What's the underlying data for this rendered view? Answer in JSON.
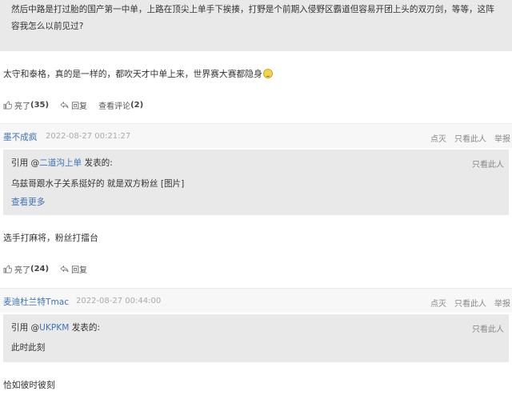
{
  "top_quote": {
    "text": "然后中路是打过胎的国产第一中单，上路在顶尖上单手下挨揍，打野是个前期入侵野区霸道但容易开团上头的双刃剑，等等，这阵容我怎么以前见过?"
  },
  "post1": {
    "reply": "太守和泰格，真的是一样的，都吹天才中单上来，世界赛大赛都隐身",
    "emoji_icon": "grinning-sweat-emoji",
    "likes_label": "亮了",
    "likes_count": "(35)",
    "reply_label": "回复",
    "view_comments_label": "查看评论",
    "view_comments_count": "(2)"
  },
  "post2": {
    "author": "墨不成疯",
    "date": "2022-08-27 00:21:27",
    "links": [
      "点灭",
      "只看此人",
      "举报"
    ],
    "quote_prefix": "引用 @",
    "quote_user": "二道沟上单",
    "quote_suffix": " 发表的:",
    "only_see": "只看此人",
    "quote_body": "乌兹哥跟水子关系挺好的 就是双方粉丝 [图片]",
    "see_more": "查看更多",
    "reply": "选手打麻将，粉丝打擂台",
    "likes_label": "亮了",
    "likes_count": "(24)",
    "reply_label": "回复"
  },
  "post3": {
    "author": "麦迪杜兰特Tmac",
    "date": "2022-08-27 00:44:00",
    "links": [
      "点灭",
      "只看此人",
      "举报"
    ],
    "quote_prefix": "引用 @",
    "quote_user": "UKPKM",
    "quote_suffix": " 发表的:",
    "only_see": "只看此人",
    "quote_body": "此时此刻",
    "reply": "恰如彼时彼刻"
  },
  "colors": {
    "link_blue": "#3d73b8",
    "quote_bg": "#e9e9e9",
    "header_bg": "#f7f7f7",
    "muted": "#aaaaaa"
  }
}
